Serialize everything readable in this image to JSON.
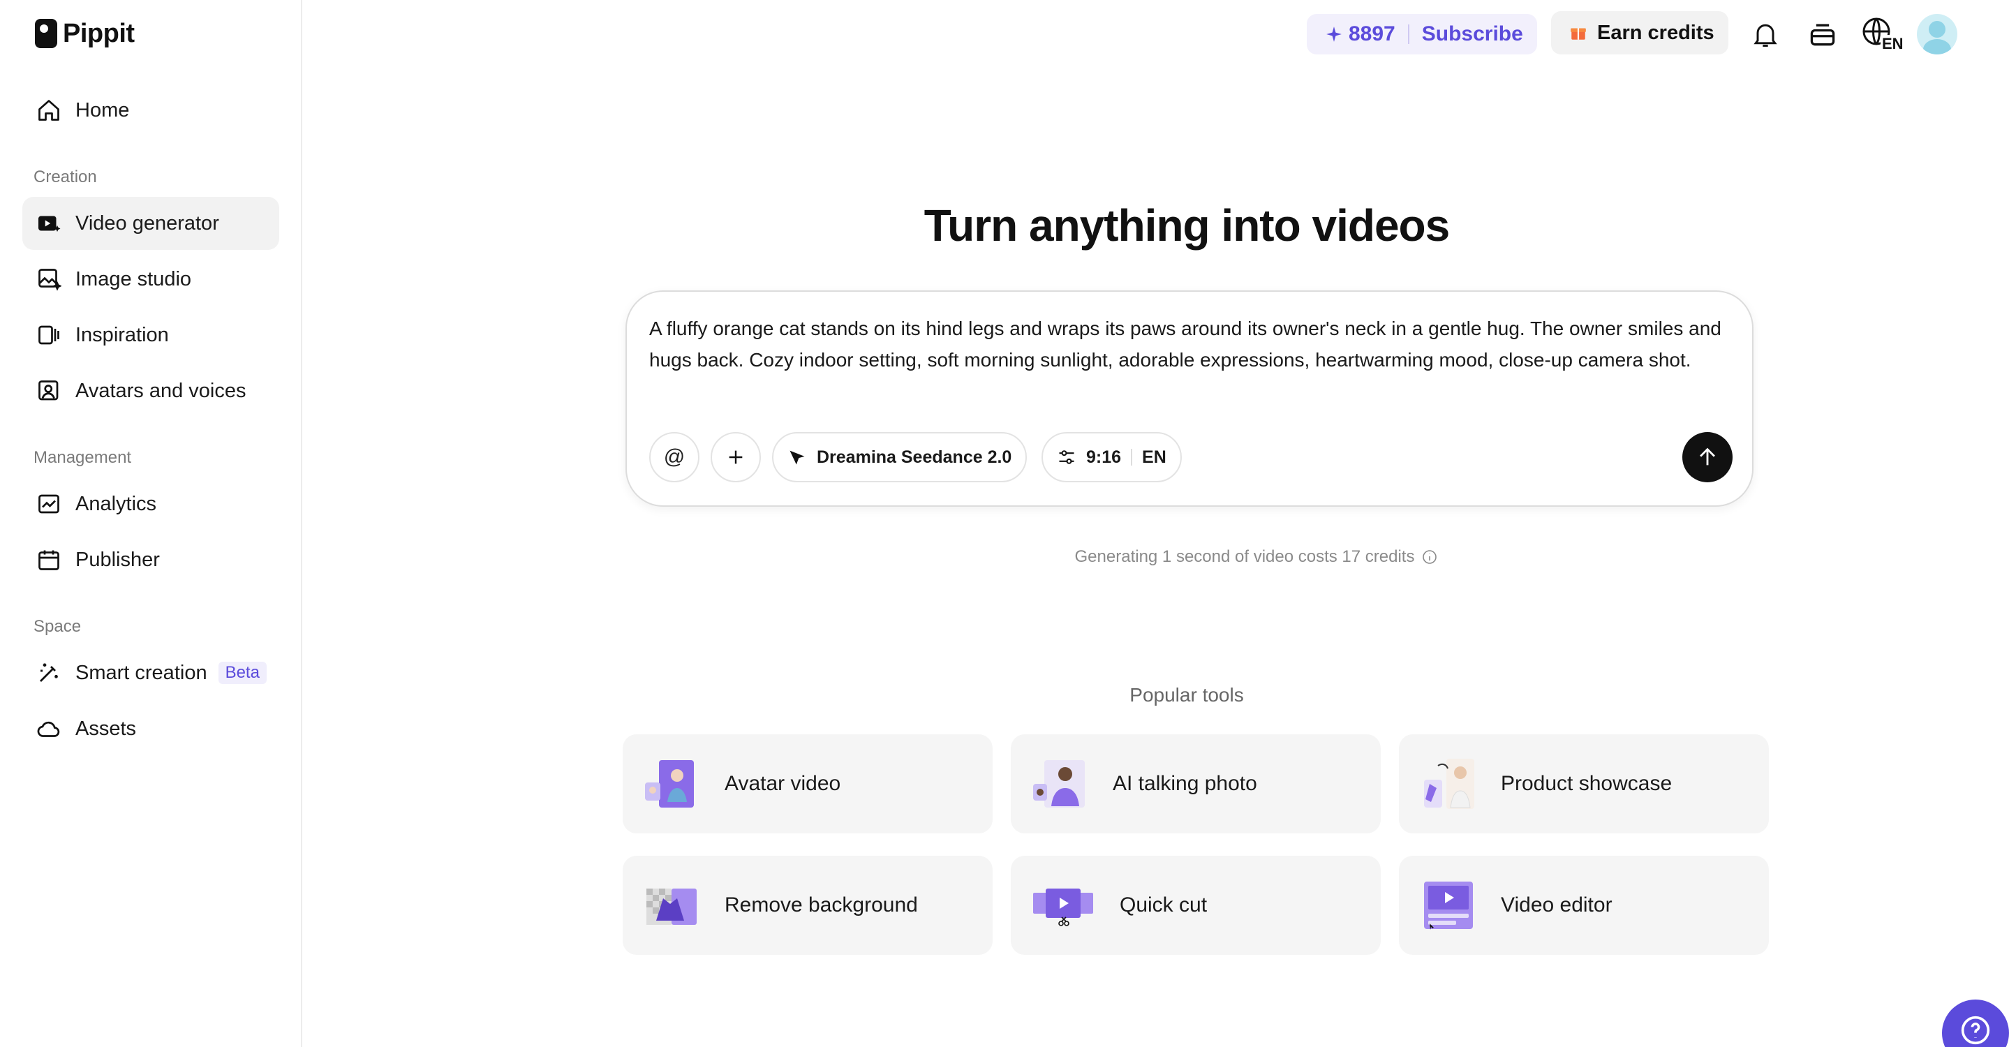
{
  "app": {
    "name": "Pippit"
  },
  "sidebar": {
    "items_top": [
      {
        "label": "Home",
        "icon": "home-icon"
      }
    ],
    "sections": [
      {
        "title": "Creation",
        "items": [
          {
            "label": "Video generator",
            "icon": "video-generator-icon",
            "active": true
          },
          {
            "label": "Image studio",
            "icon": "image-studio-icon"
          },
          {
            "label": "Inspiration",
            "icon": "inspiration-icon"
          },
          {
            "label": "Avatars and voices",
            "icon": "avatar-voice-icon"
          }
        ]
      },
      {
        "title": "Management",
        "items": [
          {
            "label": "Analytics",
            "icon": "analytics-icon"
          },
          {
            "label": "Publisher",
            "icon": "calendar-icon"
          }
        ]
      },
      {
        "title": "Space",
        "items": [
          {
            "label": "Smart creation",
            "icon": "magic-wand-icon",
            "badge": "Beta"
          },
          {
            "label": "Assets",
            "icon": "cloud-icon"
          }
        ]
      }
    ]
  },
  "header": {
    "credits": "8897",
    "subscribe_label": "Subscribe",
    "earn_label": "Earn credits",
    "language": "EN"
  },
  "main": {
    "title": "Turn anything into videos",
    "prompt": "A fluffy orange cat stands on its hind legs and wraps its paws around its owner's neck in a gentle hug. The owner smiles and hugs back. Cozy indoor setting, soft morning sunlight, adorable expressions, heartwarming mood, close-up camera shot.",
    "mention_symbol": "@",
    "model_label": "Dreamina Seedance 2.0",
    "aspect_ratio": "9:16",
    "prompt_language": "EN",
    "cost_note": "Generating 1 second of video costs 17 credits",
    "popular_label": "Popular tools",
    "tools": [
      {
        "label": "Avatar video"
      },
      {
        "label": "AI talking photo"
      },
      {
        "label": "Product showcase"
      },
      {
        "label": "Remove background"
      },
      {
        "label": "Quick cut"
      },
      {
        "label": "Video editor"
      }
    ]
  },
  "colors": {
    "accent": "#5b4bdb",
    "accent_bg": "#f2f0fc",
    "card_bg": "#f5f5f5",
    "tool_purple": "#8a6be8"
  }
}
